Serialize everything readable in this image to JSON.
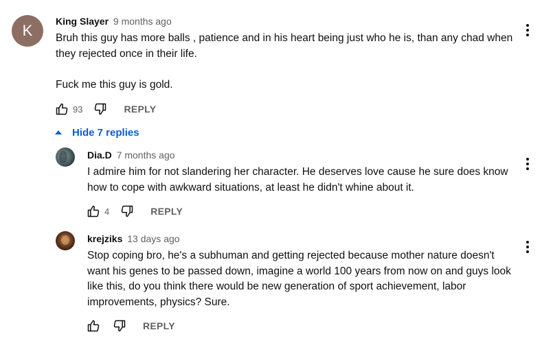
{
  "toggle": {
    "label": "Hide 7 replies"
  },
  "comments": [
    {
      "avatar_letter": "K",
      "author": "King Slayer",
      "time": "9 months ago",
      "text": "Bruh this guy has more balls , patience and in his heart being just who he is, than any chad when they rejected once in their life.\n\nFuck me this guy is gold.",
      "likes": "93",
      "reply_label": "REPLY"
    }
  ],
  "replies": [
    {
      "author": "Dia.D",
      "time": "7 months ago",
      "text": "I admire him for not slandering her character. He deserves love cause he sure does know how to cope with awkward situations, at least he didn't whine about it.",
      "likes": "4",
      "reply_label": "REPLY"
    },
    {
      "author": "krejziks",
      "time": "13 days ago",
      "text": "Stop coping bro, he's a subhuman and getting rejected because mother nature doesn't want his genes to be passed down, imagine a world 100 years from now on and guys look like this, do you think there would be new generation of sport achievement, labor improvements, physics? Sure.",
      "likes": "",
      "reply_label": "REPLY"
    }
  ],
  "colors": {
    "toggle_blue": "#065fd4",
    "muted_text": "#606060",
    "avatar_k": "#8d6e63"
  }
}
